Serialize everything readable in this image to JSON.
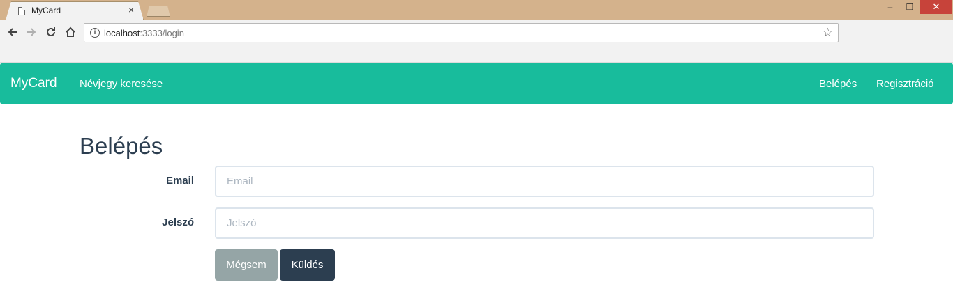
{
  "browser": {
    "tab_title": "MyCard",
    "tab_close": "×",
    "url_host": "localhost",
    "url_rest": ":3333/login",
    "window_min": "–",
    "window_max": "❐",
    "window_close": "✕",
    "icons": [
      "back-icon",
      "forward-icon",
      "reload-icon",
      "home-icon",
      "info-icon",
      "star-icon"
    ]
  },
  "navbar": {
    "brand": "MyCard",
    "search_link": "Névjegy keresése",
    "login_link": "Belépés",
    "register_link": "Regisztráció",
    "color": "#18bc9c"
  },
  "form": {
    "title": "Belépés",
    "email_label": "Email",
    "email_placeholder": "Email",
    "email_value": "",
    "password_label": "Jelszó",
    "password_placeholder": "Jelszó",
    "password_value": "",
    "cancel_label": "Mégsem",
    "submit_label": "Küldés"
  },
  "colors": {
    "text_dark": "#2c3e50",
    "cancel_button": "#95a5a6",
    "submit_button": "#2c3e50"
  }
}
